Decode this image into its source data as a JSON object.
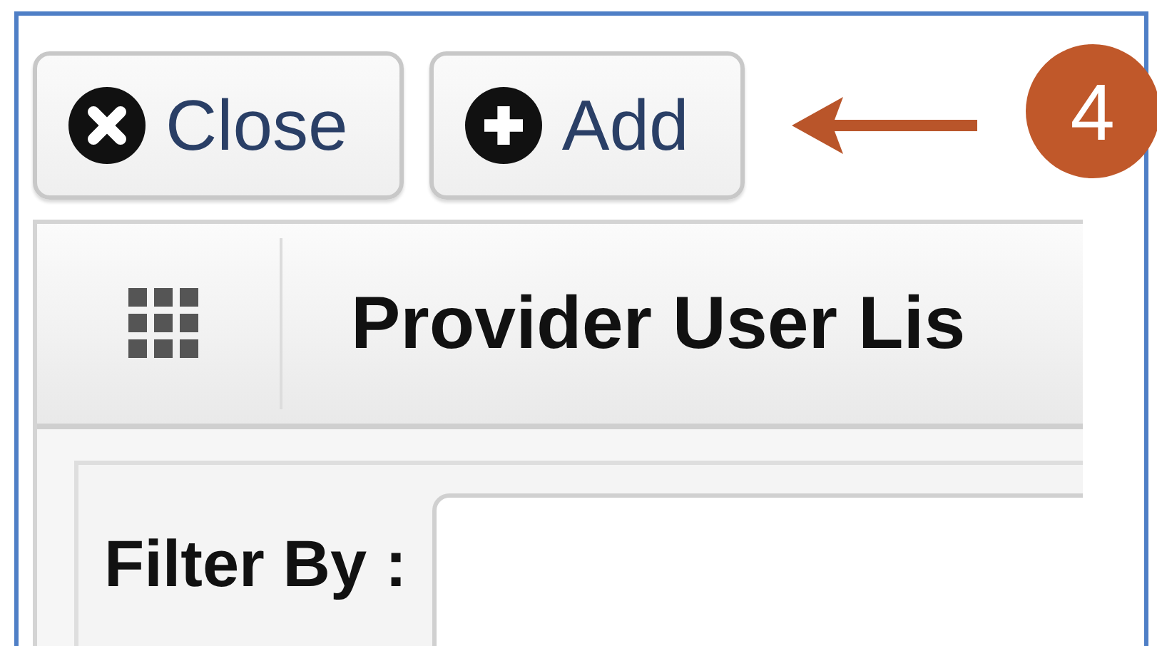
{
  "toolbar": {
    "buttons": [
      {
        "label": "Close",
        "kind": "close"
      },
      {
        "label": "Add",
        "kind": "add"
      }
    ]
  },
  "callout": {
    "number": "4"
  },
  "panel": {
    "title": "Provider User Lis",
    "filter": {
      "label": "Filter By :"
    }
  }
}
